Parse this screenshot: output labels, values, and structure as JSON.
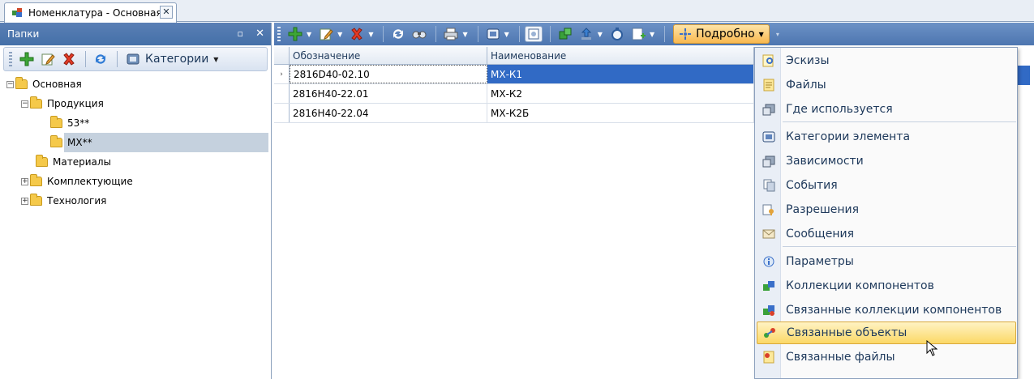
{
  "doc_tab": {
    "title": "Номенклатура - Основная",
    "close": "✕"
  },
  "left_panel": {
    "title": "Папки",
    "pin": "ᵖ",
    "close": "✕",
    "toolbar": {
      "categories_label": "Категории"
    },
    "tree": {
      "root": "Основная",
      "products": "Продукция",
      "f53": "53**",
      "mx": "МХ**",
      "materials": "Материалы",
      "components": "Комплектующие",
      "technology": "Технология",
      "expander_minus": "−",
      "expander_plus": "+"
    }
  },
  "main": {
    "toolbar": {
      "details_label": "Подробно"
    },
    "grid": {
      "headers": [
        "Обозначение",
        "Наименование"
      ],
      "rows": [
        {
          "code": "2816D40-02.10",
          "name": "МХ-К1"
        },
        {
          "code": "2816H40-22.01",
          "name": "МХ-К2"
        },
        {
          "code": "2816H40-22.04",
          "name": "МХ-К2Б"
        }
      ],
      "row_indicator": "›"
    }
  },
  "menu": {
    "items": [
      "Эскизы",
      "Файлы",
      "Где используется",
      "Категории элемента",
      "Зависимости",
      "События",
      "Разрешения",
      "Сообщения",
      "Параметры",
      "Коллекции компонентов",
      "Связанные коллекции компонентов",
      "Связанные объекты",
      "Связанные файлы"
    ],
    "highlighted_index": 11
  }
}
